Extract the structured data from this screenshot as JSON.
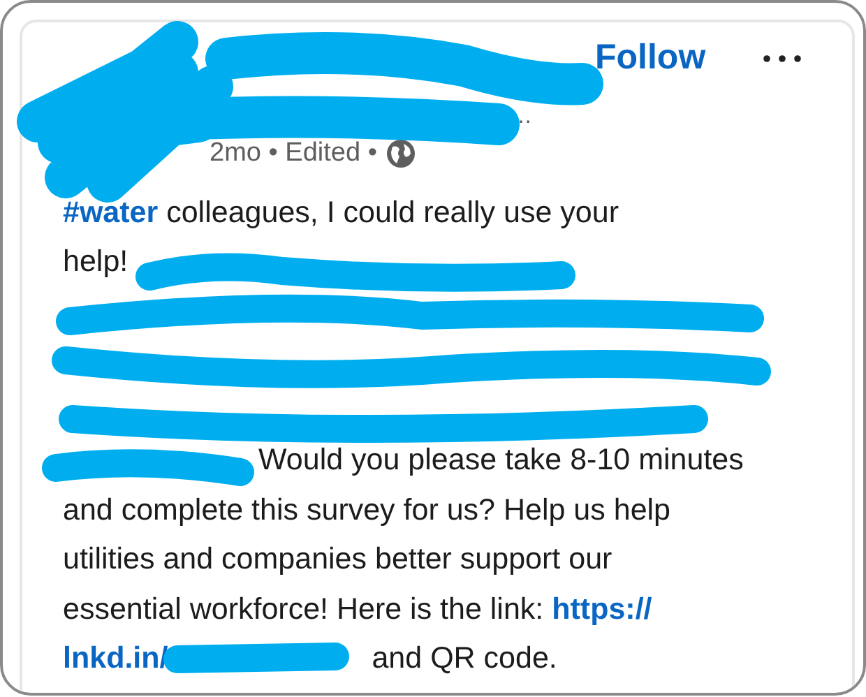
{
  "header": {
    "follow_label": "Follow",
    "subtitle_tail": "…",
    "meta": "2mo • Edited •"
  },
  "body": [
    {
      "kind": "text",
      "segments": [
        {
          "kind": "hashtag",
          "text": "#water"
        },
        {
          "kind": "plain",
          "text": " colleagues, I could really use your"
        }
      ]
    },
    {
      "kind": "text",
      "segments": [
        {
          "kind": "plain",
          "text": "help!"
        }
      ]
    },
    {
      "kind": "redacted"
    },
    {
      "kind": "redacted"
    },
    {
      "kind": "redacted"
    },
    {
      "kind": "text",
      "segments": [
        {
          "kind": "redacted"
        },
        {
          "kind": "plain",
          "text": "Would you please take 8-10 minutes"
        }
      ]
    },
    {
      "kind": "text",
      "segments": [
        {
          "kind": "plain",
          "text": "and complete this survey for us? Help us help"
        }
      ]
    },
    {
      "kind": "text",
      "segments": [
        {
          "kind": "plain",
          "text": "utilities and companies better support our"
        }
      ]
    },
    {
      "kind": "text",
      "segments": [
        {
          "kind": "plain",
          "text": "essential workforce! Here is the link: "
        },
        {
          "kind": "link",
          "text": "https://"
        }
      ]
    },
    {
      "kind": "text",
      "segments": [
        {
          "kind": "link",
          "text": "lnkd.in/"
        },
        {
          "kind": "redacted"
        },
        {
          "kind": "plain",
          "text": " and QR code."
        }
      ]
    }
  ]
}
